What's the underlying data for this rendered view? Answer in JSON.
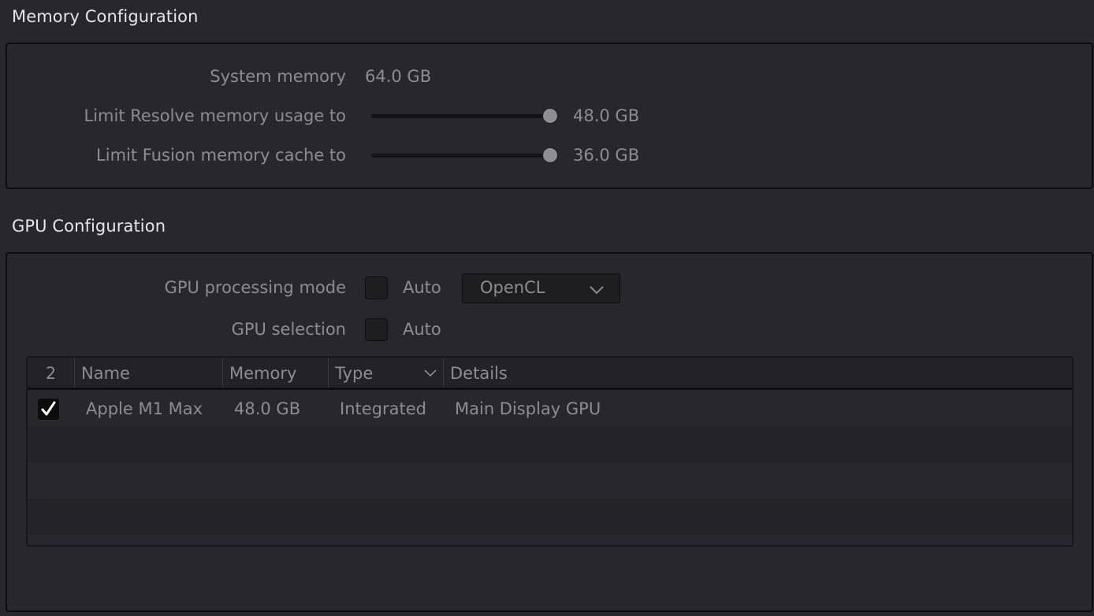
{
  "memory": {
    "title": "Memory Configuration",
    "system_memory_label": "System memory",
    "system_memory_value": "64.0 GB",
    "resolve_limit": {
      "label": "Limit Resolve memory usage to",
      "value_text": "48.0 GB",
      "value_gb": 48.0,
      "max_gb": 48.0
    },
    "fusion_limit": {
      "label": "Limit Fusion memory cache to",
      "value_text": "36.0 GB",
      "value_gb": 36.0,
      "max_gb": 36.0
    }
  },
  "gpu": {
    "title": "GPU Configuration",
    "processing_mode": {
      "label": "GPU processing mode",
      "auto_label": "Auto",
      "auto_checked": false,
      "selected": "OpenCL"
    },
    "selection": {
      "label": "GPU selection",
      "auto_label": "Auto",
      "auto_checked": false
    },
    "table": {
      "columns": {
        "count": "2",
        "name": "Name",
        "memory": "Memory",
        "type": "Type",
        "details": "Details"
      },
      "rows": [
        {
          "checked": true,
          "name": "Apple M1 Max",
          "memory": "48.0 GB",
          "type": "Integrated",
          "details": "Main Display GPU"
        }
      ]
    }
  }
}
